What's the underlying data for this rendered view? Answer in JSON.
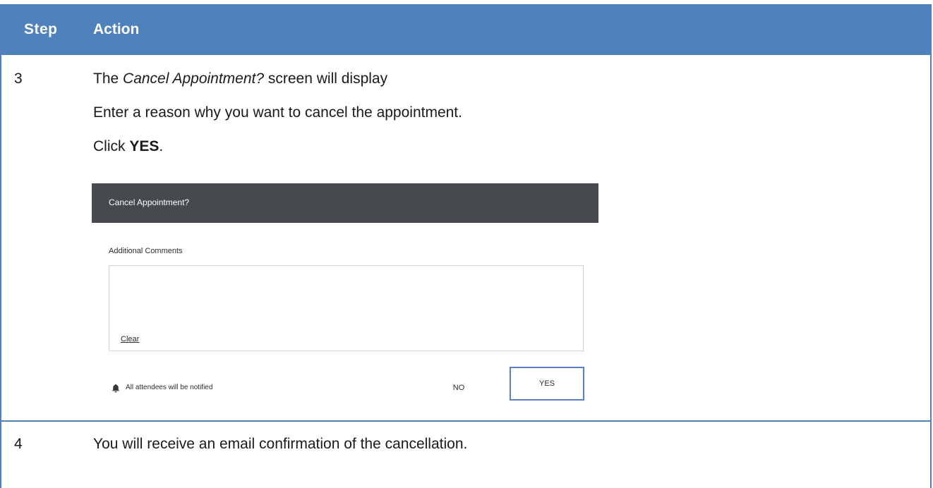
{
  "table": {
    "headers": {
      "step": "Step",
      "action": "Action"
    },
    "rows": [
      {
        "step": "3",
        "intro_prefix": "The ",
        "intro_italic": "Cancel Appointment?",
        "intro_suffix": " screen will display",
        "instruction": "Enter a reason why you want to cancel the appointment.",
        "click_prefix": "Click ",
        "click_bold": "YES",
        "click_suffix": "."
      },
      {
        "step": "4",
        "text": "You will receive an email confirmation of the cancellation."
      }
    ]
  },
  "dialog": {
    "title": "Cancel Appointment?",
    "comments_label": "Additional Comments",
    "comments_value": "",
    "clear_label": "Clear",
    "notify_icon": "bell-icon",
    "notify_text": "All attendees will be notified",
    "no_label": "NO",
    "yes_label": "YES"
  },
  "colors": {
    "header_bg": "#4f81bd",
    "dialog_titlebar": "#46494e",
    "yes_border": "#5b7fc2"
  }
}
